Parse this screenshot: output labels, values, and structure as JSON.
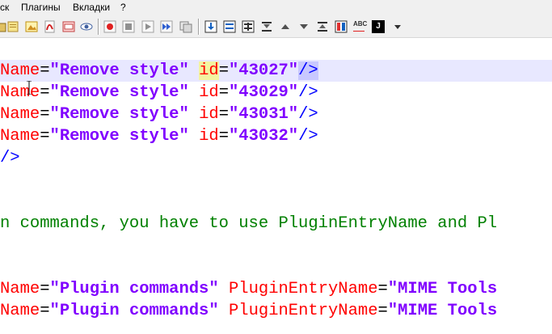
{
  "menu": {
    "item1": "ск",
    "item2": "Плагины",
    "item3": "Вкладки",
    "item4": "?"
  },
  "toolbar": {
    "icons": [
      "new-folder-icon",
      "note-icon",
      "image-icon",
      "pdf-icon",
      "document-icon",
      "eye-icon",
      "record-macro-icon",
      "stop-icon",
      "play-icon",
      "fast-forward-icon",
      "save-macro-icon",
      "insert-icon",
      "list-icon",
      "table-icon",
      "expand-icon",
      "up-arrow-icon",
      "down-arrow-icon",
      "collapse-icon",
      "columns-icon",
      "spellcheck-icon",
      "java-icon",
      "dropdown-icon"
    ],
    "spellcheck_label": "ABC",
    "java_label": "J"
  },
  "editor": {
    "lines": [
      {
        "attr1": "Name",
        "val1": "\"Remove style\"",
        "attr2": "id",
        "val2": "\"43027\"",
        "close": "/>"
      },
      {
        "attr1": "Name",
        "val1": "\"Remove style\"",
        "attr2": "id",
        "val2": "\"43029\"",
        "close": "/>"
      },
      {
        "attr1": "Name",
        "val1": "\"Remove style\"",
        "attr2": "id",
        "val2": "\"43031\"",
        "close": "/>"
      },
      {
        "attr1": "Name",
        "val1": "\"Remove style\"",
        "attr2": "id",
        "val2": "\"43032\"",
        "close": "/>"
      }
    ],
    "closing_tag": "/>",
    "comment": "n commands, you have to use PluginEntryName and Pl",
    "plugin_lines": [
      {
        "attr1": "Name",
        "val1": "\"Plugin commands\"",
        "attr2": "PluginEntryName",
        "val2": "\"MIME Tools"
      },
      {
        "attr1": "Name",
        "val1": "\"Plugin commands\"",
        "attr2": "PluginEntryName",
        "val2": "\"MIME Tools"
      }
    ],
    "equals": "="
  },
  "colors": {
    "attribute": "#ff0000",
    "string": "#8000ff",
    "tag": "#0000ff",
    "comment": "#008000",
    "current_line": "#e8e8ff"
  }
}
